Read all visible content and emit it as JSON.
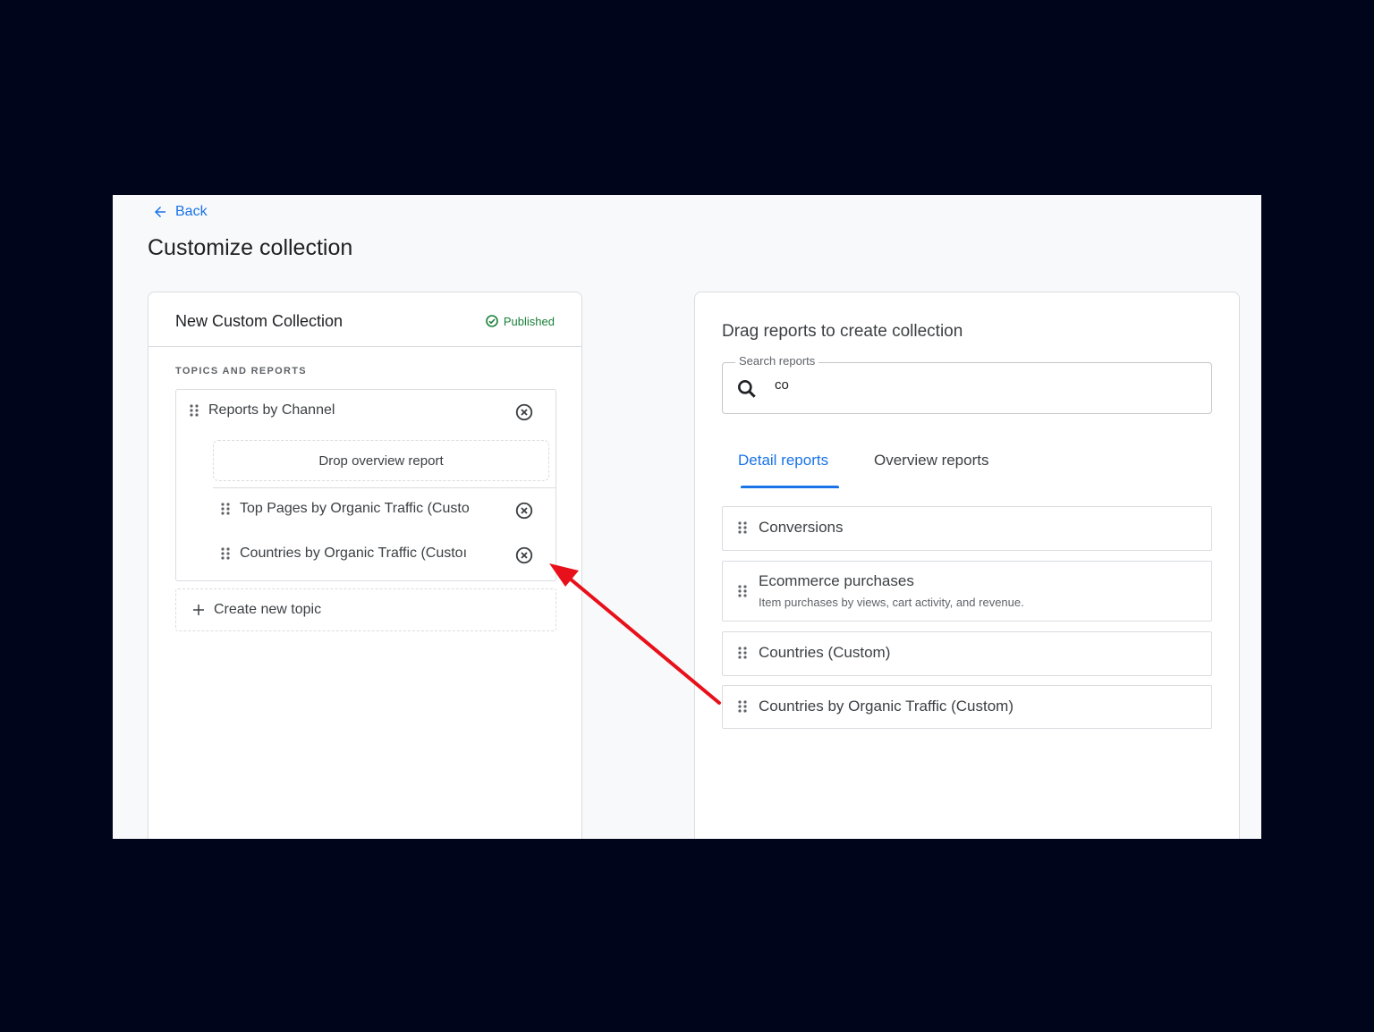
{
  "nav": {
    "back_label": "Back"
  },
  "page": {
    "title": "Customize collection"
  },
  "collection": {
    "name": "New Custom Collection",
    "status": "Published",
    "section_label": "TOPICS AND REPORTS",
    "topic": {
      "name": "Reports by Channel",
      "drop_placeholder": "Drop overview report",
      "reports": [
        "Top Pages by Organic Traffic (Custo",
        "Countries by Organic Traffic (Custoı"
      ]
    },
    "create_topic_label": "Create new topic"
  },
  "library": {
    "title": "Drag reports to create collection",
    "search": {
      "label": "Search reports",
      "value": "co"
    },
    "tabs": [
      {
        "label": "Detail reports",
        "active": true
      },
      {
        "label": "Overview reports",
        "active": false
      }
    ],
    "reports": [
      {
        "name": "Conversions",
        "description": ""
      },
      {
        "name": "Ecommerce purchases",
        "description": "Item purchases by views, cart activity, and revenue."
      },
      {
        "name": "Countries (Custom)",
        "description": ""
      },
      {
        "name": "Countries by Organic Traffic (Custom)",
        "description": ""
      }
    ]
  },
  "colors": {
    "accent": "#1a73e8",
    "published": "#188038",
    "annotation_arrow": "#e8101a",
    "backdrop": "#00051c"
  }
}
